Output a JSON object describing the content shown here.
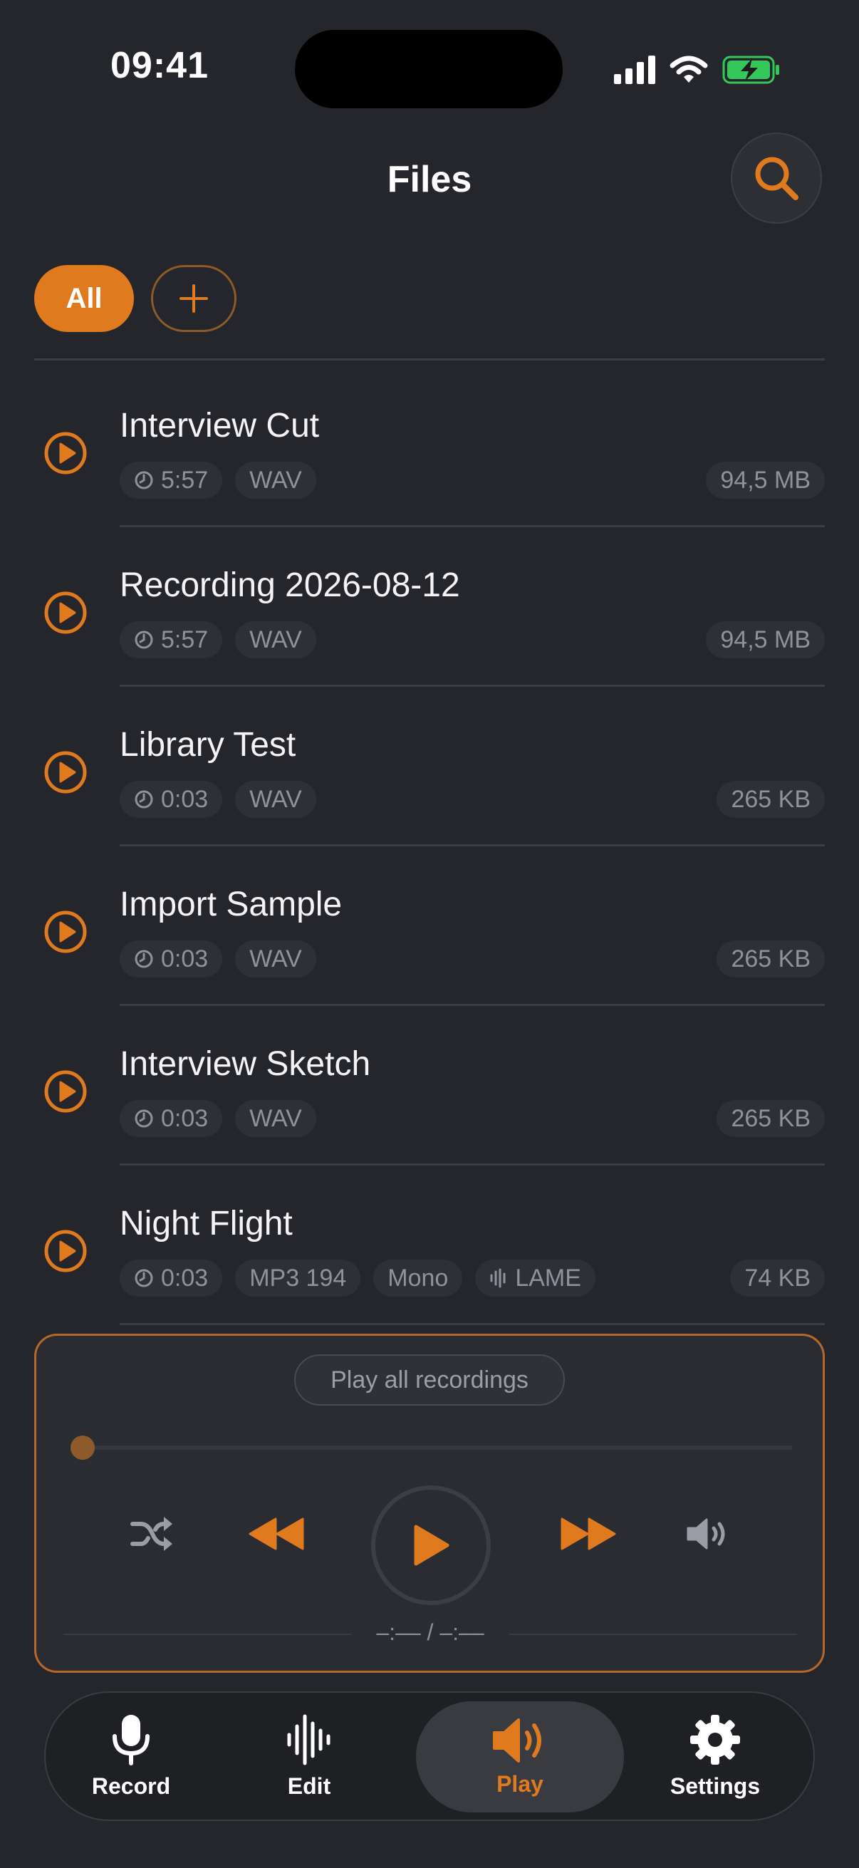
{
  "status_bar": {
    "time": "09:41"
  },
  "header": {
    "title": "Files"
  },
  "filters": {
    "all_label": "All"
  },
  "files": [
    {
      "title": "Interview Cut",
      "duration": "5:57",
      "format": "WAV",
      "channels": "",
      "encoder": "",
      "size": "94,5 MB"
    },
    {
      "title": "Recording 2026-08-12",
      "duration": "5:57",
      "format": "WAV",
      "channels": "",
      "encoder": "",
      "size": "94,5 MB"
    },
    {
      "title": "Library Test",
      "duration": "0:03",
      "format": "WAV",
      "channels": "",
      "encoder": "",
      "size": "265 KB"
    },
    {
      "title": "Import Sample",
      "duration": "0:03",
      "format": "WAV",
      "channels": "",
      "encoder": "",
      "size": "265 KB"
    },
    {
      "title": "Interview Sketch",
      "duration": "0:03",
      "format": "WAV",
      "channels": "",
      "encoder": "",
      "size": "265 KB"
    },
    {
      "title": "Night Flight",
      "duration": "0:03",
      "format": "MP3 194",
      "channels": "Mono",
      "encoder": "LAME",
      "size": "74 KB"
    }
  ],
  "player": {
    "play_all_label": "Play all recordings",
    "time_readout": "–:–– / –:––",
    "progress": 0
  },
  "tabs": [
    {
      "label": "Record",
      "icon": "microphone-icon",
      "active": false
    },
    {
      "label": "Edit",
      "icon": "waveform-icon",
      "active": false
    },
    {
      "label": "Play",
      "icon": "speaker-icon",
      "active": true
    },
    {
      "label": "Settings",
      "icon": "gear-icon",
      "active": false
    }
  ],
  "colors": {
    "accent": "#e07a1f",
    "background": "#25262b",
    "pill": "#2e3037",
    "muted_text": "#8f929b"
  }
}
